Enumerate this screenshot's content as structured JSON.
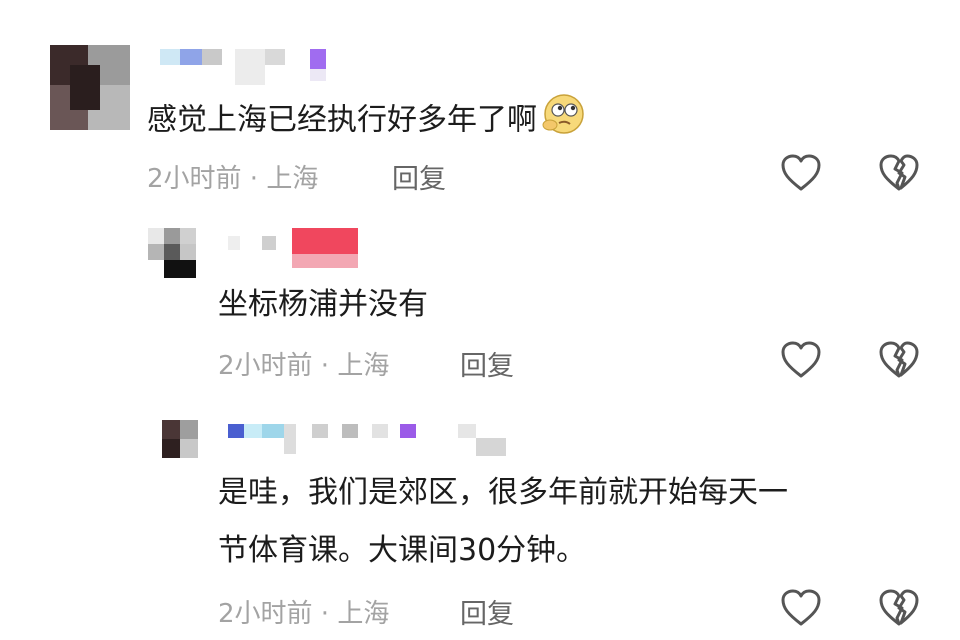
{
  "comments": [
    {
      "text": "感觉上海已经执行好多年了啊",
      "emoji_icon": "pondering-face-emoji-icon",
      "meta": "2小时前 · 上海",
      "reply_label": "回复"
    },
    {
      "text": "坐标杨浦并没有",
      "meta": "2小时前 · 上海",
      "reply_label": "回复"
    },
    {
      "text_lines": [
        "是哇，我们是郊区，很多年前就开始每天一",
        "节体育课。大课间30分钟。"
      ],
      "meta": "2小时前 · 上海",
      "reply_label": "回复"
    }
  ],
  "icons": {
    "like": "heart-outline-icon",
    "dislike": "broken-heart-outline-icon"
  },
  "colors": {
    "meta_gray": "#a3a3a3",
    "reply_gray": "#666666",
    "icon_gray": "#555555"
  }
}
